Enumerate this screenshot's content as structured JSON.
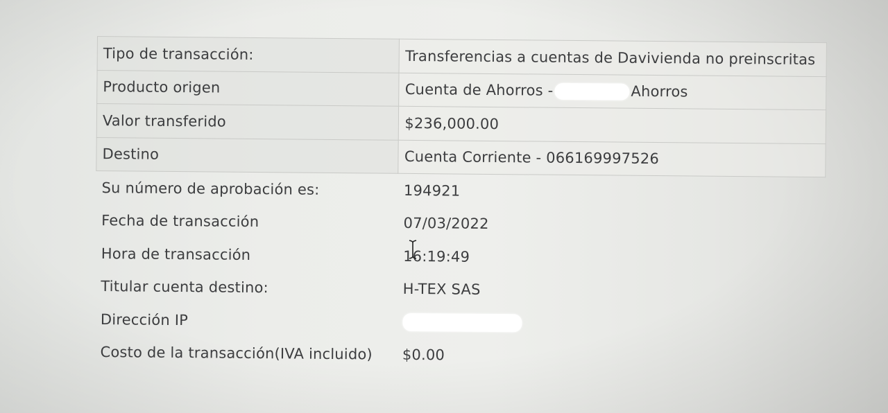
{
  "rows": [
    {
      "label": "Tipo de transacción:",
      "value": "Transferencias a cuentas de Davivienda no preinscritas"
    },
    {
      "label": "Producto origen",
      "value_prefix": "Cuenta de Ahorros -",
      "value_suffix": "Ahorros"
    },
    {
      "label": "Valor transferido",
      "value": "$236,000.00"
    },
    {
      "label": "Destino",
      "value": "Cuenta Corriente - 066169997526"
    },
    {
      "label": "Su número de aprobación es:",
      "value": "194921"
    },
    {
      "label": "Fecha de transacción",
      "value": "07/03/2022"
    },
    {
      "label": "Hora de transacción",
      "value": "16:19:49"
    },
    {
      "label": "Titular cuenta destino:",
      "value": "H-TEX SAS"
    },
    {
      "label": "Dirección IP",
      "value": ""
    },
    {
      "label": "Costo de la transacción(IVA incluido)",
      "value": "$0.00"
    }
  ],
  "cursor": "text-cursor-icon"
}
